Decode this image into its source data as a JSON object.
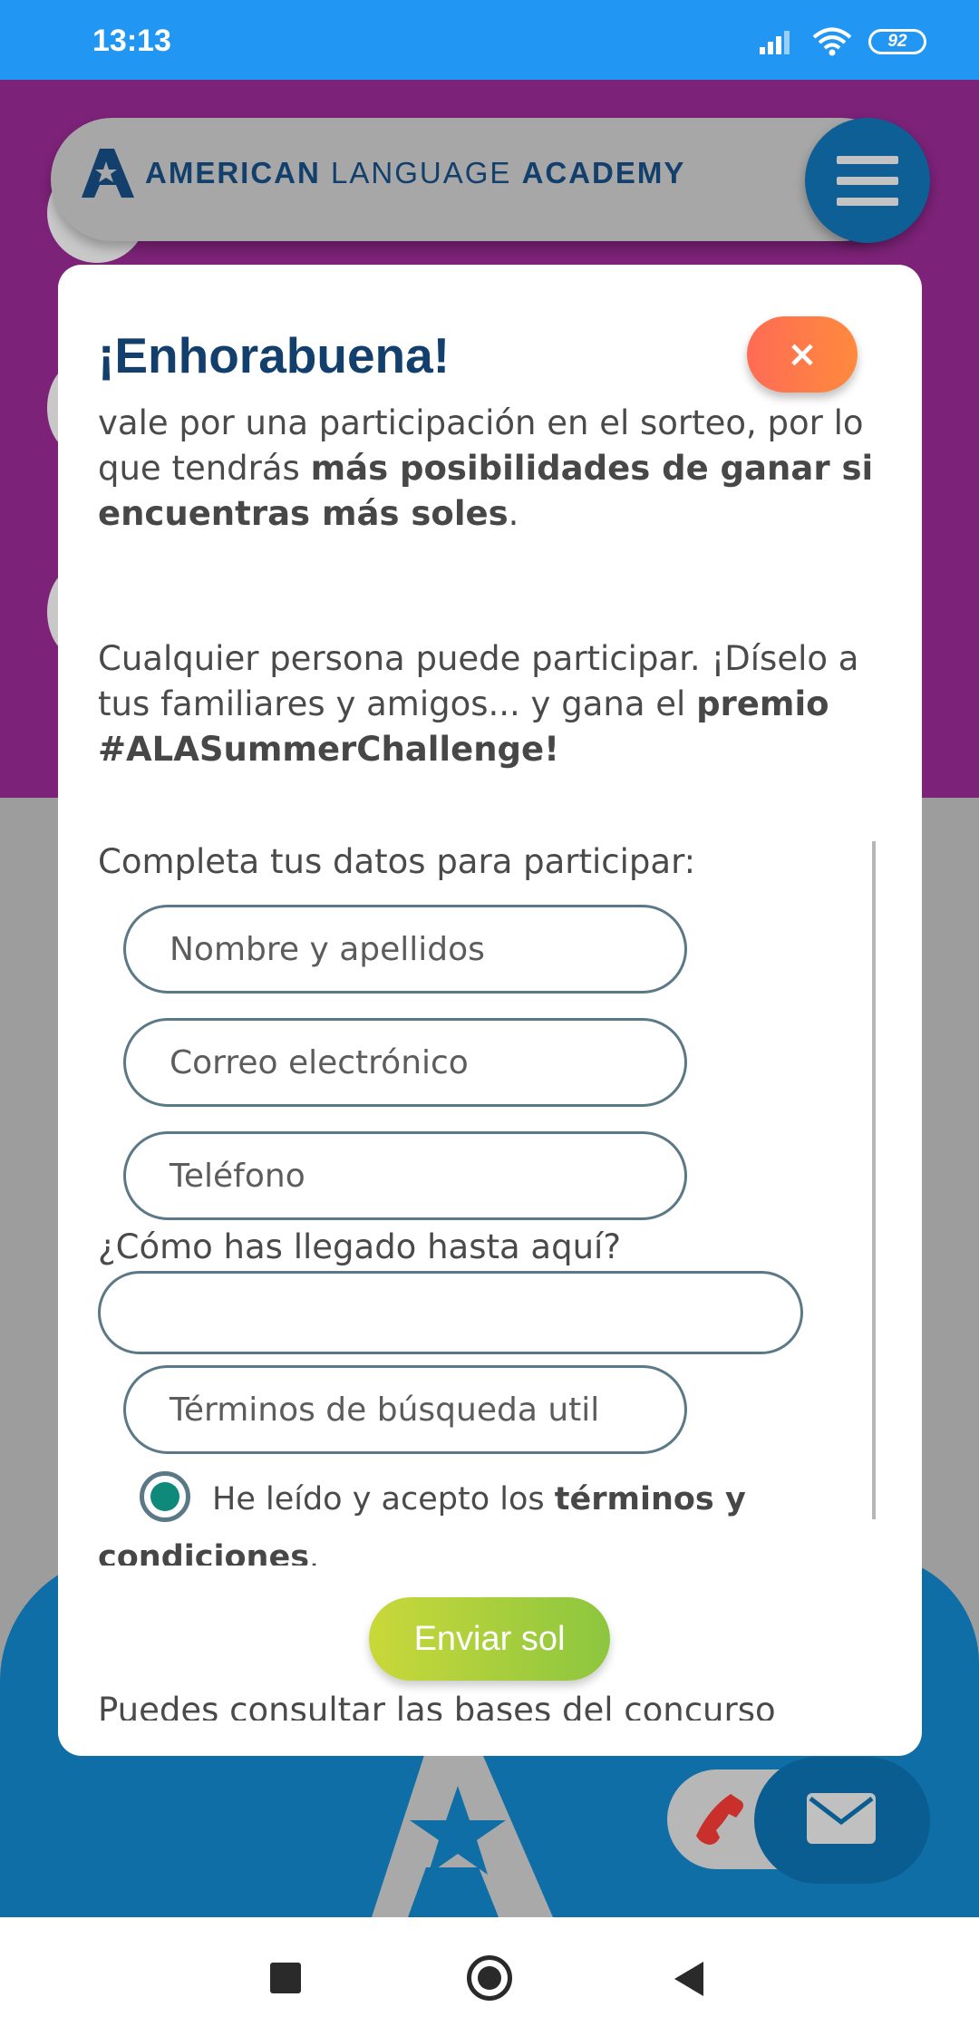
{
  "status_bar": {
    "time": "13:13",
    "battery": "92"
  },
  "header": {
    "logo_bold_1": "AMERICAN",
    "logo_light": "LANGUAGE",
    "logo_bold_2": "ACADEMY"
  },
  "modal": {
    "title": "¡Enhorabuena!",
    "close_label": "×",
    "p1_text": "vale por una participación en el sorteo, por lo que tendrás ",
    "p1_bold": "más posibilidades de ganar si encuentras más soles",
    "p1_end": ".",
    "p2_text": "Cualquier persona puede participar. ¡Díselo a tus familiares y amigos... y gana el ",
    "p2_bold": "premio #ALASummerChallenge!",
    "form_label": "Completa tus datos para participar:",
    "fields": {
      "name_placeholder": "Nombre y apellidos",
      "email_placeholder": "Correo electrónico",
      "phone_placeholder": "Teléfono",
      "how_label": "¿Cómo has llegado hasta aquí?",
      "how_value": "",
      "terms_placeholder": "Términos de búsqueda util"
    },
    "consent_text": "He leído y acepto los ",
    "consent_bold": "términos y condiciones",
    "consent_end": ".",
    "send_label": "Enviar sol",
    "more_text": "Puedes consultar las bases del concurso"
  },
  "colors": {
    "status_bar": "#2196f3",
    "purple_bg": "#7c2278",
    "title": "#123f6b",
    "close_button": "#ff6b55",
    "send_button": "#a6cf3a",
    "radio_selected": "#0f8a7a"
  },
  "icons": [
    "signal-icon",
    "wifi-icon",
    "battery-icon",
    "menu-icon",
    "close-icon",
    "phone-icon",
    "mail-icon",
    "recents-icon",
    "home-icon",
    "back-icon"
  ]
}
